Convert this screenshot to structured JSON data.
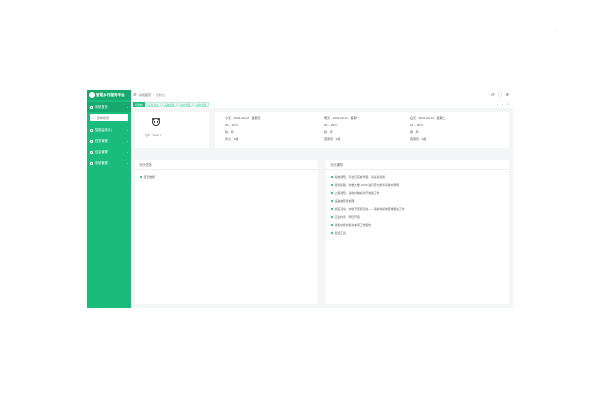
{
  "app": {
    "title": "智慧乡村服务平台"
  },
  "sidebar": {
    "search_placeholder": "菜单搜索",
    "items": [
      {
        "label": "系统首页",
        "chevron": "›"
      },
      {
        "label": "智能监测(1)",
        "chevron": "›"
      },
      {
        "label": "任务管理",
        "chevron": "›"
      },
      {
        "label": "信息管理",
        "chevron": "›"
      },
      {
        "label": "系统管理",
        "chevron": "›"
      }
    ]
  },
  "topbar": {
    "menu_icon": "menu-icon",
    "breadcrumb": [
      "系统首页",
      "控制台"
    ],
    "breadcrumb_sep": "/",
    "icons": [
      "refresh-icon",
      "fullscreen-icon",
      "settings-icon"
    ]
  },
  "tabs": [
    {
      "label": "控制台"
    },
    {
      "label": "任务列表"
    },
    {
      "label": "设备管理"
    },
    {
      "label": "用户管理"
    },
    {
      "label": "角色管理"
    }
  ],
  "tab_controls": [
    "‹",
    "›",
    "×"
  ],
  "profile": {
    "name": "用户 · Super 1"
  },
  "weather": [
    {
      "date": "今天 · 2023-09-10 · 星期日",
      "temp": "25 ~ 31°C",
      "wind": "晴  · 风",
      "aqi": "风力 · 3级"
    },
    {
      "date": "明天 · 2023-09-11 · 星期一",
      "temp": "26 ~ 32°C",
      "wind": "晴  · 风",
      "aqi": "西南风 · 2级"
    },
    {
      "date": "后天 · 2023-09-12 · 星期二",
      "temp": "24 ~ 30°C",
      "wind": "阴  · 风",
      "aqi": "西南风 · 2级"
    }
  ],
  "panels": {
    "left": {
      "title": "今日任务",
      "items": [
        "暂无数据"
      ]
    },
    "right": {
      "title": "今日通知",
      "items": [
        "系统通知：平台已完成升级，请注意使用",
        "巡查提醒：村委大楼 10:00 进行安全检查请准时到场",
        "上级通知：请各村做好防汛准备工作",
        "设备故障待处理",
        "社区活动：中秋节庆祝活动——请各村提前安排相关工作",
        "卫生检查：明日开展",
        "请各村按时提交本周工作报告",
        "反馈汇总"
      ]
    }
  }
}
